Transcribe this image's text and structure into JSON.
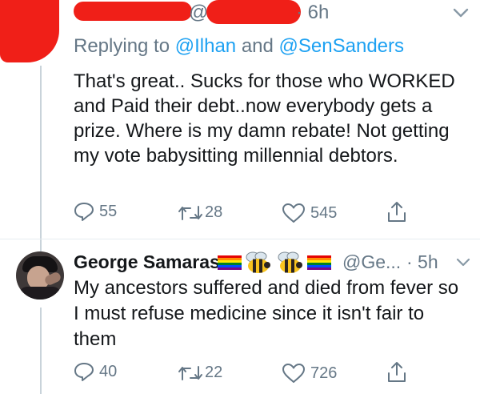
{
  "tweet1": {
    "handle_prefix": "@",
    "time": "· 6h",
    "replying_label": "Replying to",
    "replying_to_1": "@Ilhan",
    "replying_and": "and",
    "replying_to_2": "@SenSanders",
    "text": "That's great.. Sucks for those who WORKED and Paid their debt..now everybody gets a prize. Where is my damn rebate! Not getting my vote babysitting millennial debtors.",
    "replies": "55",
    "retweets": "28",
    "likes": "545"
  },
  "tweet2": {
    "name": "George Samaras",
    "handle": "@Ge...",
    "time": "· 5h",
    "text": "My ancestors suffered and died from fever so I must refuse medicine since it isn't fair to them",
    "replies": "40",
    "retweets": "22",
    "likes": "726"
  },
  "icons": {
    "reply": "reply-icon",
    "retweet": "retweet-icon",
    "like": "heart-icon",
    "share": "share-icon",
    "menu": "chevron-down-icon",
    "flag": "rainbow-flag-icon",
    "bee": "bee-icon"
  },
  "colors": {
    "accent": "#1da1f2",
    "meta": "#657786",
    "redaction": "#f01f18"
  }
}
